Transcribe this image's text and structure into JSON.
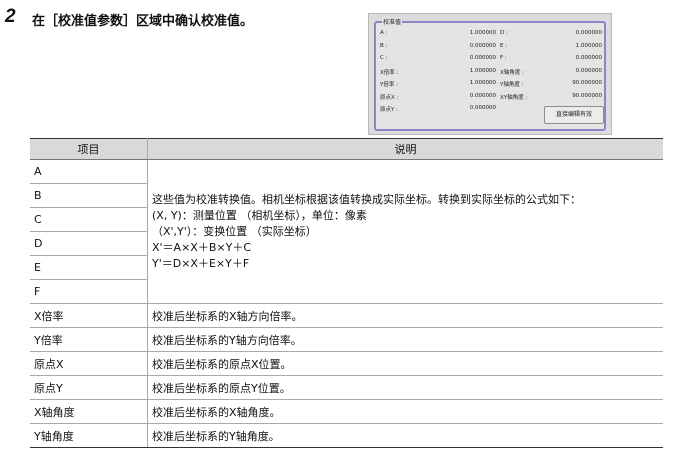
{
  "step": {
    "number": "2",
    "text": "在［校准值参数］区域中确认校准值。"
  },
  "panel": {
    "group_title": "校准值",
    "rows": [
      {
        "l1": "A :",
        "v1": "1.000000",
        "l2": "D :",
        "v2": "0.000000"
      },
      {
        "l1": "B :",
        "v1": "0.000000",
        "l2": "E :",
        "v2": "1.000000"
      },
      {
        "l1": "C :",
        "v1": "0.000000",
        "l2": "F :",
        "v2": "0.000000"
      },
      {
        "l1": "X倍率 :",
        "v1": "1.000000",
        "l2": "X轴角度 :",
        "v2": "0.000000"
      },
      {
        "l1": "Y倍率 :",
        "v1": "1.000000",
        "l2": "Y轴角度 :",
        "v2": "90.000000"
      },
      {
        "l1": "原点X :",
        "v1": "0.000000",
        "l2": "XY轴角度 :",
        "v2": "90.000000"
      },
      {
        "l1": "原点Y :",
        "v1": "0.000000",
        "l2": "",
        "v2": ""
      }
    ],
    "apply_button": "直接编辑有效"
  },
  "table": {
    "headers": [
      "项目",
      "说明"
    ],
    "abcdef_items": [
      "A",
      "B",
      "C",
      "D",
      "E",
      "F"
    ],
    "abcdef_desc": [
      "这些值为校准转换值。相机坐标根据该值转换成实际坐标。转换到实际坐标的公式如下：",
      "(X, Y)：测量位置 （相机坐标），单位：像素",
      "（X',Y'）：变换位置 （实际坐标）",
      "X'＝A×X＋B×Y＋C",
      "Y'＝D×X＋E×Y＋F"
    ],
    "rows": [
      {
        "item": "X倍率",
        "desc": "校准后坐标系的X轴方向倍率。"
      },
      {
        "item": "Y倍率",
        "desc": "校准后坐标系的Y轴方向倍率。"
      },
      {
        "item": "原点X",
        "desc": "校准后坐标系的原点X位置。"
      },
      {
        "item": "原点Y",
        "desc": "校准后坐标系的原点Y位置。"
      },
      {
        "item": "X轴角度",
        "desc": "校准后坐标系的X轴角度。"
      },
      {
        "item": "Y轴角度",
        "desc": "校准后坐标系的Y轴角度。"
      }
    ]
  }
}
